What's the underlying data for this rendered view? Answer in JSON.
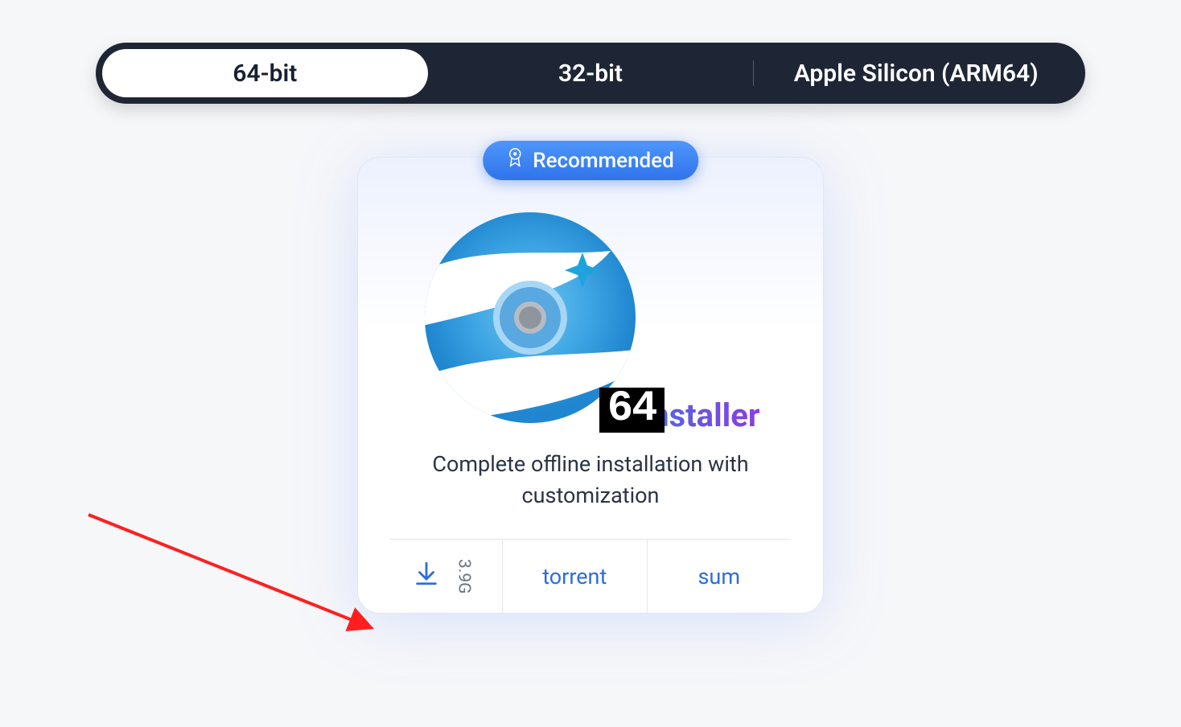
{
  "arch": {
    "options": [
      "64-bit",
      "32-bit",
      "Apple Silicon (ARM64)"
    ],
    "selected": "64-bit"
  },
  "card": {
    "badge": "Recommended",
    "arch_badge": "64",
    "title": "Installer",
    "subtitle": "Complete offline installation with customization",
    "size": "3.9G",
    "links": {
      "torrent": "torrent",
      "sum": "sum"
    }
  }
}
